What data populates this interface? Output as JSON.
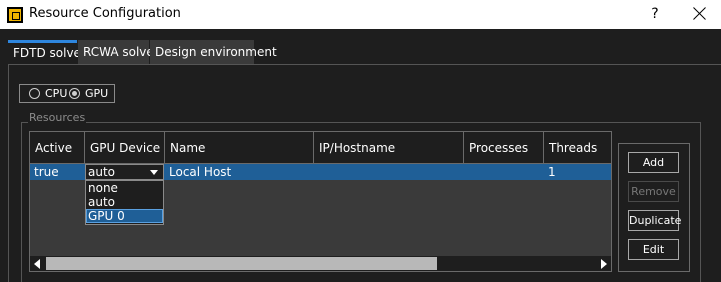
{
  "window": {
    "title": "Resource Configuration",
    "help": "?"
  },
  "tabs": [
    {
      "label": "FDTD solver",
      "active": true
    },
    {
      "label": "RCWA solver",
      "active": false
    },
    {
      "label": "Design environment",
      "active": false
    }
  ],
  "mode": {
    "cpu_label": "CPU",
    "gpu_label": "GPU",
    "selected": "GPU"
  },
  "resources": {
    "group_label": "Resources",
    "columns": [
      "Active",
      "GPU Device",
      "Name",
      "IP/Hostname",
      "Processes",
      "Threads"
    ],
    "rows": [
      {
        "active": "true",
        "gpu_device": "auto",
        "name": "Local Host",
        "ip": "",
        "processes": "",
        "threads": "1"
      }
    ],
    "gpu_device_options": [
      "none",
      "auto",
      "GPU 0"
    ],
    "gpu_device_highlighted": "GPU 0"
  },
  "buttons": {
    "add": "Add",
    "remove": "Remove",
    "duplicate": "Duplicate",
    "edit": "Edit"
  },
  "colors": {
    "selection": "#1f5f97",
    "tab_accent": "#2e86de",
    "background": "#1e1e1e"
  }
}
